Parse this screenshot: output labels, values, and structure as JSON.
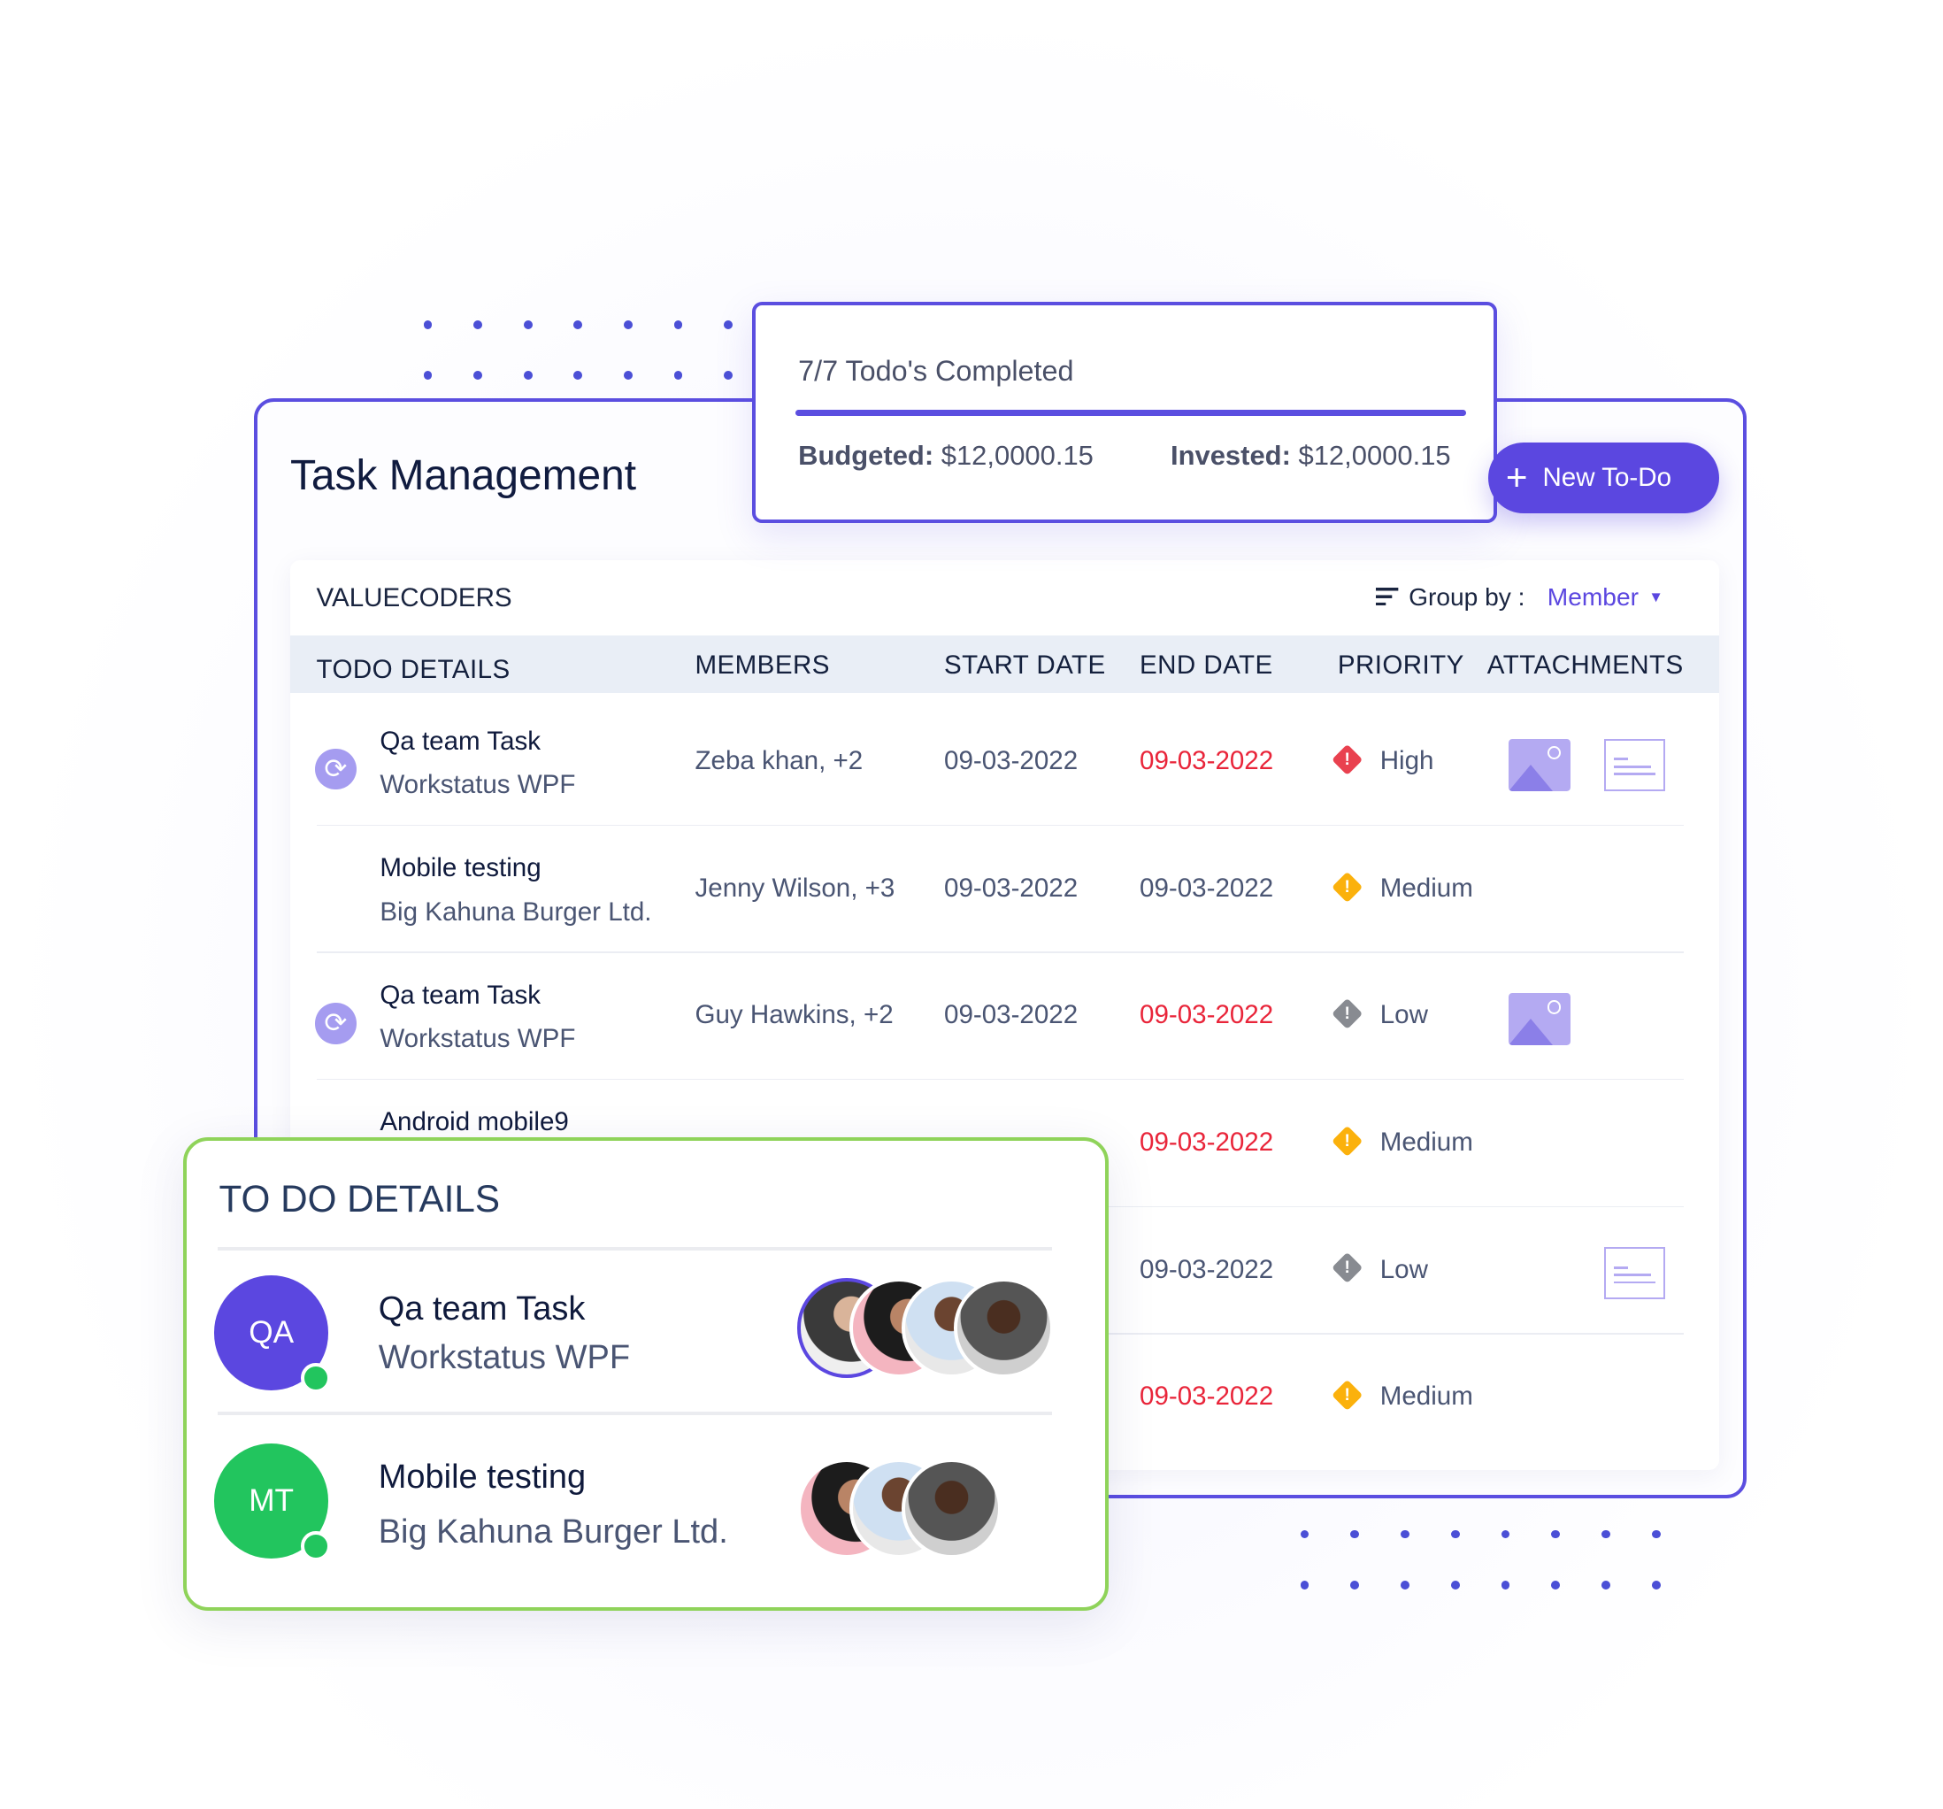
{
  "summary": {
    "completed_text": "7/7 Todo's Completed",
    "progress": 1.0,
    "budgeted_label": "Budgeted:",
    "budgeted_value": "$12,0000.15",
    "invested_label": "Invested:",
    "invested_value": "$12,0000.15"
  },
  "header": {
    "title": "Task Management",
    "new_button": "New To-Do",
    "plus_icon": "+"
  },
  "table": {
    "organization": "VALUECODERS",
    "group_by_label": "Group by :",
    "group_by_value": "Member",
    "columns": [
      "TODO DETAILS",
      "MEMBERS",
      "START DATE",
      "END DATE",
      "PRIORITY",
      "ATTACHMENTS"
    ],
    "rows": [
      {
        "name": "Qa team Task",
        "project": "Workstatus WPF",
        "members": "Zeba khan, +2",
        "start": "09-03-2022",
        "end": "09-03-2022",
        "end_overdue": true,
        "priority": "High",
        "recurring": true,
        "attachments": [
          "image",
          "document"
        ]
      },
      {
        "name": "Mobile testing",
        "project": "Big Kahuna Burger Ltd.",
        "members": "Jenny Wilson, +3",
        "start": "09-03-2022",
        "end": "09-03-2022",
        "end_overdue": false,
        "priority": "Medium",
        "recurring": false,
        "attachments": []
      },
      {
        "name": "Qa team Task",
        "project": "Workstatus WPF",
        "members": "Guy Hawkins, +2",
        "start": "09-03-2022",
        "end": "09-03-2022",
        "end_overdue": true,
        "priority": "Low",
        "recurring": true,
        "attachments": [
          "image"
        ]
      },
      {
        "name": "Android mobile9",
        "end": "09-03-2022",
        "end_overdue": true,
        "priority": "Medium"
      },
      {
        "end": "09-03-2022",
        "end_overdue": false,
        "priority": "Low",
        "attachments": [
          "document"
        ]
      },
      {
        "end": "09-03-2022",
        "end_overdue": true,
        "priority": "Medium"
      }
    ]
  },
  "details_card": {
    "title": "TO DO DETAILS",
    "items": [
      {
        "initials": "QA",
        "name": "Qa team Task",
        "project": "Workstatus WPF",
        "color": "#5b47e0",
        "online": true,
        "member_count": 4
      },
      {
        "initials": "MT",
        "name": "Mobile testing",
        "project": "Big Kahuna Burger Ltd.",
        "color": "#22c55e",
        "online": true,
        "member_count": 3
      }
    ]
  },
  "colors": {
    "accent": "#5b4ee0",
    "overdue": "#e9253a",
    "high": "#e9414f",
    "medium": "#fbb10c",
    "low": "#888b91",
    "card_border": "#8fd35a"
  }
}
